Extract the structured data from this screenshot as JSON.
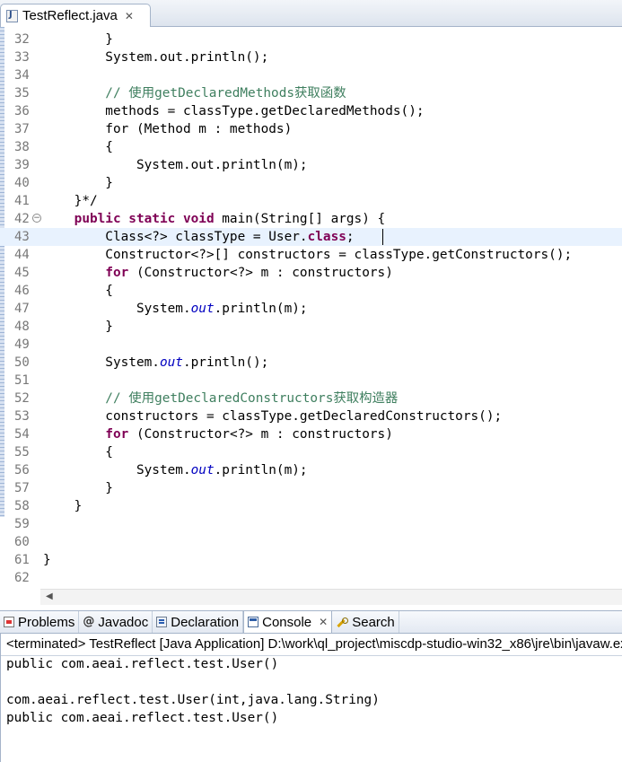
{
  "editor_tab": {
    "title": "TestReflect.java",
    "close": "✕"
  },
  "code_lines": [
    {
      "num": "32",
      "parts": [
        {
          "t": "        }",
          "c": ""
        }
      ]
    },
    {
      "num": "33",
      "parts": [
        {
          "t": "        System.out.println();",
          "c": ""
        }
      ]
    },
    {
      "num": "34",
      "parts": []
    },
    {
      "num": "35",
      "parts": [
        {
          "t": "        // 使用getDeclaredMethods获取函数",
          "c": "cm"
        }
      ]
    },
    {
      "num": "36",
      "parts": [
        {
          "t": "        methods = classType.getDeclaredMethods();",
          "c": ""
        }
      ]
    },
    {
      "num": "37",
      "parts": [
        {
          "t": "        for (Method m : methods)",
          "c": ""
        }
      ]
    },
    {
      "num": "38",
      "parts": [
        {
          "t": "        {",
          "c": ""
        }
      ]
    },
    {
      "num": "39",
      "parts": [
        {
          "t": "            System.out.println(m);",
          "c": ""
        }
      ]
    },
    {
      "num": "40",
      "parts": [
        {
          "t": "        }",
          "c": ""
        }
      ]
    },
    {
      "num": "41",
      "parts": [
        {
          "t": "    }*/",
          "c": ""
        }
      ]
    },
    {
      "num": "42",
      "fold": "−",
      "parts": [
        {
          "t": "    ",
          "c": ""
        },
        {
          "t": "public static void",
          "c": "kw"
        },
        {
          "t": " main(String[] args) {",
          "c": ""
        }
      ]
    },
    {
      "num": "43",
      "current": true,
      "parts": [
        {
          "t": "        Class<?> classType = User.",
          "c": ""
        },
        {
          "t": "class",
          "c": "kw"
        },
        {
          "t": ";",
          "c": ""
        }
      ]
    },
    {
      "num": "44",
      "parts": [
        {
          "t": "        Constructor<?>[] constructors = classType.getConstructors();",
          "c": ""
        }
      ]
    },
    {
      "num": "45",
      "parts": [
        {
          "t": "        ",
          "c": ""
        },
        {
          "t": "for",
          "c": "kw"
        },
        {
          "t": " (Constructor<?> m : constructors)",
          "c": ""
        }
      ]
    },
    {
      "num": "46",
      "parts": [
        {
          "t": "        {",
          "c": ""
        }
      ]
    },
    {
      "num": "47",
      "parts": [
        {
          "t": "            System.",
          "c": ""
        },
        {
          "t": "out",
          "c": "st"
        },
        {
          "t": ".println(m);",
          "c": ""
        }
      ]
    },
    {
      "num": "48",
      "parts": [
        {
          "t": "        }",
          "c": ""
        }
      ]
    },
    {
      "num": "49",
      "parts": []
    },
    {
      "num": "50",
      "parts": [
        {
          "t": "        System.",
          "c": ""
        },
        {
          "t": "out",
          "c": "st"
        },
        {
          "t": ".println();",
          "c": ""
        }
      ]
    },
    {
      "num": "51",
      "parts": []
    },
    {
      "num": "52",
      "parts": [
        {
          "t": "        // 使用getDeclaredConstructors获取构造器",
          "c": "cm"
        }
      ]
    },
    {
      "num": "53",
      "parts": [
        {
          "t": "        constructors = classType.getDeclaredConstructors();",
          "c": ""
        }
      ]
    },
    {
      "num": "54",
      "parts": [
        {
          "t": "        ",
          "c": ""
        },
        {
          "t": "for",
          "c": "kw"
        },
        {
          "t": " (Constructor<?> m : constructors)",
          "c": ""
        }
      ]
    },
    {
      "num": "55",
      "parts": [
        {
          "t": "        {",
          "c": ""
        }
      ]
    },
    {
      "num": "56",
      "parts": [
        {
          "t": "            System.",
          "c": ""
        },
        {
          "t": "out",
          "c": "st"
        },
        {
          "t": ".println(m);",
          "c": ""
        }
      ]
    },
    {
      "num": "57",
      "parts": [
        {
          "t": "        }",
          "c": ""
        }
      ]
    },
    {
      "num": "58",
      "parts": [
        {
          "t": "    }",
          "c": ""
        }
      ]
    },
    {
      "num": "59",
      "parts": []
    },
    {
      "num": "60",
      "parts": []
    },
    {
      "num": "61",
      "parts": [
        {
          "t": "}",
          "c": ""
        }
      ]
    },
    {
      "num": "62",
      "parts": []
    }
  ],
  "scroll_left": "◀",
  "view_tabs": [
    {
      "label": "Problems",
      "icon": "problems-icon"
    },
    {
      "label": "Javadoc",
      "icon": "javadoc-icon",
      "glyph": "@"
    },
    {
      "label": "Declaration",
      "icon": "declaration-icon"
    },
    {
      "label": "Console",
      "icon": "console-icon",
      "active": true,
      "close": "✕"
    },
    {
      "label": "Search",
      "icon": "search-icon"
    }
  ],
  "console": {
    "status": "<terminated> TestReflect [Java Application] D:\\work\\ql_project\\miscdp-studio-win32_x86\\jre\\bin\\javaw.exe",
    "output": [
      "public com.aeai.reflect.test.User()",
      "",
      "com.aeai.reflect.test.User(int,java.lang.String)",
      "public com.aeai.reflect.test.User()"
    ]
  },
  "colors": {
    "keyword": "#7f0055",
    "comment": "#3f7f5f",
    "static_field": "#0000c0",
    "current_line": "#e8f2fe"
  }
}
